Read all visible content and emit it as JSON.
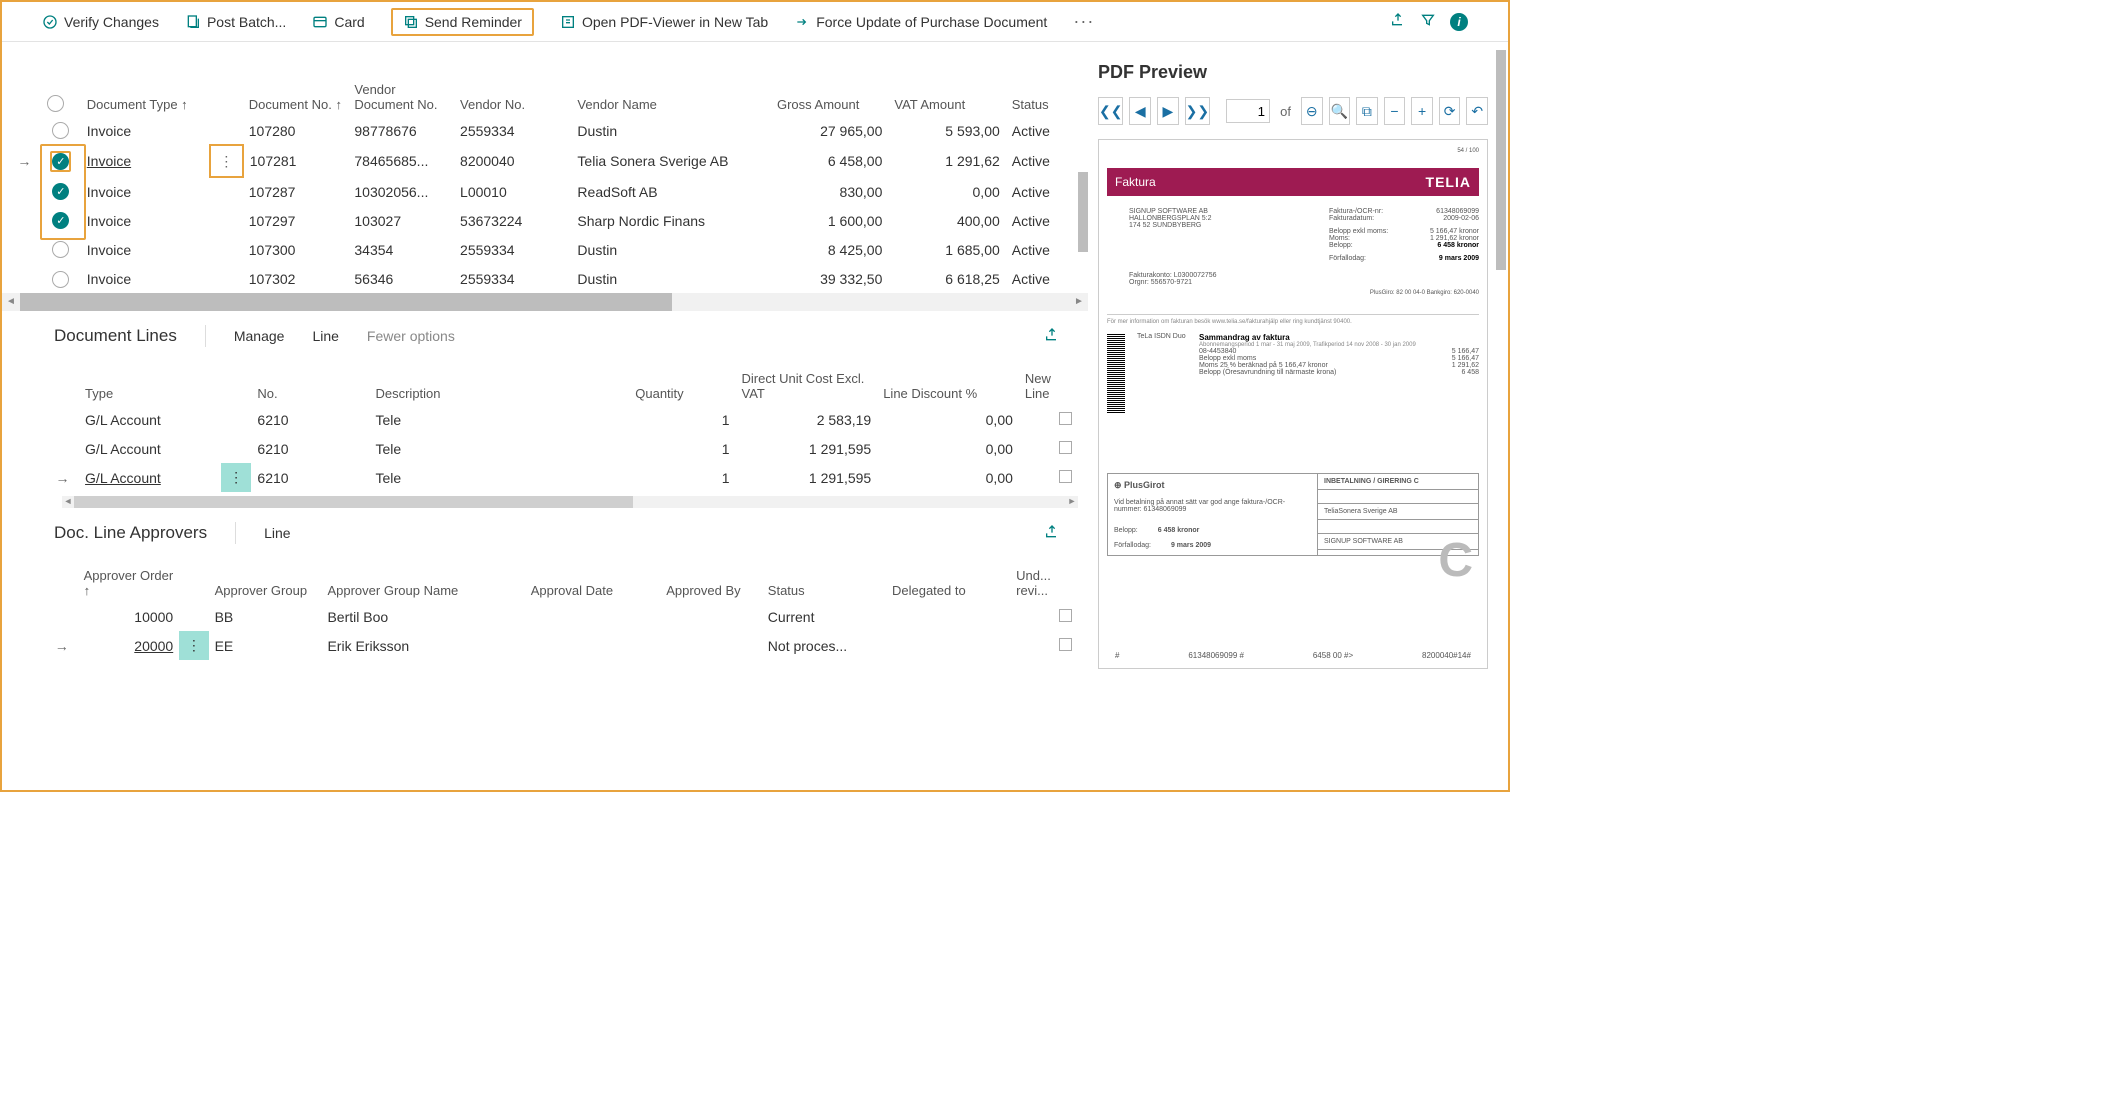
{
  "toolbar": {
    "verify": "Verify Changes",
    "postbatch": "Post Batch...",
    "card": "Card",
    "sendreminder": "Send Reminder",
    "openpdf": "Open PDF-Viewer in New Tab",
    "forceupdate": "Force Update of Purchase Document",
    "more": "···"
  },
  "grid1": {
    "cols": {
      "doctype": "Document Type ↑",
      "docno": "Document No. ↑",
      "vdocno": "Vendor Document No.",
      "vendorno": "Vendor No.",
      "vendorname": "Vendor Name",
      "gross": "Gross Amount",
      "vat": "VAT Amount",
      "status": "Status"
    },
    "rows": [
      {
        "sel": "empty",
        "doctype": "Invoice",
        "docno": "107280",
        "vdocno": "98778676",
        "vendorno": "2559334",
        "vname": "Dustin",
        "gross": "27 965,00",
        "vat": "5 593,00",
        "status": "Active",
        "current": false
      },
      {
        "sel": "checked",
        "doctype": "Invoice",
        "docno": "107281",
        "vdocno": "78465685...",
        "vendorno": "8200040",
        "vname": "Telia Sonera Sverige AB",
        "gross": "6 458,00",
        "vat": "1 291,62",
        "status": "Active",
        "current": true
      },
      {
        "sel": "checked",
        "doctype": "Invoice",
        "docno": "107287",
        "vdocno": "10302056...",
        "vendorno": "L00010",
        "vname": "ReadSoft AB",
        "gross": "830,00",
        "vat": "0,00",
        "status": "Active",
        "current": false
      },
      {
        "sel": "checked",
        "doctype": "Invoice",
        "docno": "107297",
        "vdocno": "103027",
        "vendorno": "53673224",
        "vname": "Sharp Nordic Finans",
        "gross": "1 600,00",
        "vat": "400,00",
        "status": "Active",
        "current": false
      },
      {
        "sel": "empty",
        "doctype": "Invoice",
        "docno": "107300",
        "vdocno": "34354",
        "vendorno": "2559334",
        "vname": "Dustin",
        "gross": "8 425,00",
        "vat": "1 685,00",
        "status": "Active",
        "current": false
      },
      {
        "sel": "empty",
        "doctype": "Invoice",
        "docno": "107302",
        "vdocno": "56346",
        "vendorno": "2559334",
        "vname": "Dustin",
        "gross": "39 332,50",
        "vat": "6 618,25",
        "status": "Active",
        "current": false
      }
    ]
  },
  "lines": {
    "title": "Document Lines",
    "actions": {
      "manage": "Manage",
      "line": "Line",
      "fewer": "Fewer options"
    },
    "cols": {
      "type": "Type",
      "no": "No.",
      "desc": "Description",
      "qty": "Quantity",
      "duc": "Direct Unit Cost Excl. VAT",
      "ldisc": "Line Discount %",
      "newline": "New Line"
    },
    "rows": [
      {
        "type": "G/L Account",
        "no": "6210",
        "desc": "Tele",
        "qty": "1",
        "duc": "2 583,19",
        "ldisc": "0,00",
        "current": false
      },
      {
        "type": "G/L Account",
        "no": "6210",
        "desc": "Tele",
        "qty": "1",
        "duc": "1 291,595",
        "ldisc": "0,00",
        "current": false
      },
      {
        "type": "G/L Account",
        "no": "6210",
        "desc": "Tele",
        "qty": "1",
        "duc": "1 291,595",
        "ldisc": "0,00",
        "current": true
      }
    ]
  },
  "approvers": {
    "title": "Doc. Line Approvers",
    "actions": {
      "line": "Line"
    },
    "cols": {
      "order": "Approver Order ↑",
      "group": "Approver Group",
      "name": "Approver Group Name",
      "date": "Approval Date",
      "by": "Approved By",
      "status": "Status",
      "delto": "Delegated to",
      "und": "Und... revi..."
    },
    "rows": [
      {
        "order": "10000",
        "group": "BB",
        "name": "Bertil Boo",
        "date": "",
        "by": "",
        "status": "Current",
        "delto": "",
        "current": false
      },
      {
        "order": "20000",
        "group": "EE",
        "name": "Erik Eriksson",
        "date": "",
        "by": "",
        "status": "Not proces...",
        "delto": "",
        "current": true
      }
    ]
  },
  "pdf": {
    "title": "PDF Preview",
    "page": "1",
    "of": "of",
    "doc": {
      "faktura": "Faktura",
      "brand": "TELIA",
      "topnote": "54 / 100",
      "addr1": "SIGNUP SOFTWARE AB",
      "addr2": "HALLONBERGSPLAN 5:2",
      "addr3": "174 52   SUNDBYBERG",
      "r_fno": "Faktura-/OCR-nr:",
      "r_fno_v": "61348069099",
      "r_fdate": "Fakturadatum:",
      "r_fdate_v": "2009-02-06",
      "r_exkl": "Belopp exkl moms:",
      "r_exkl_v": "5 166,47 kronor",
      "r_moms": "Moms:",
      "r_moms_v": "1 291,62 kronor",
      "r_belopp": "Belopp:",
      "r_belopp_v": "6 458 kronor",
      "r_forf": "Förfallodag:",
      "r_forf_v": "9 mars 2009",
      "fkonto": "Fakturakonto: L0300072756",
      "orgnr": "Orgnr: 556570-9721",
      "plus": "PlusGiro: 82 00 04-0     Bankgiro: 620-0040",
      "midtxt": "För mer information om fakturan besök www.telia.se/fakturahjälp eller ring kundtjänst 90400.",
      "sum_title": "Sammandrag av faktura",
      "sum_sub": "Abonnemangsperiod 1 mar - 31 maj 2009, Trafikperiod 14 nov 2008 - 30 jan 2009",
      "sum_name": "TeLa ISDN Duo",
      "sum_l1": "08-4453840",
      "sum_l1_v": "5 166,47",
      "sum_l2": "Belopp exkl moms",
      "sum_l2_v": "5 166,47",
      "sum_l3": "Moms 25 % beräknad på 5 166,47 kronor",
      "sum_l3_v": "1 291,62",
      "sum_l4": "Belopp (Öresavrundning till närmaste krona)",
      "sum_l4_v": "6 458",
      "pg_brand": "⊕ PlusGirot",
      "pg_title": "INBETALNING / GIRERING C",
      "pg_note": "Vid betalning på annat sätt var god ange faktura-/OCR-nummer: 61348069099",
      "pg_bel": "Belopp:",
      "pg_bel_v": "6 458 kronor",
      "pg_forf": "Förfallodag:",
      "pg_forf_v": "9 mars 2009",
      "pg_right1": "TeliaSonera Sverige AB",
      "pg_right2": "SIGNUP SOFTWARE AB",
      "foot1": "#",
      "foot2": "61348069099 #",
      "foot3": "6458  00    #>",
      "foot4": "8200040#14#"
    }
  }
}
